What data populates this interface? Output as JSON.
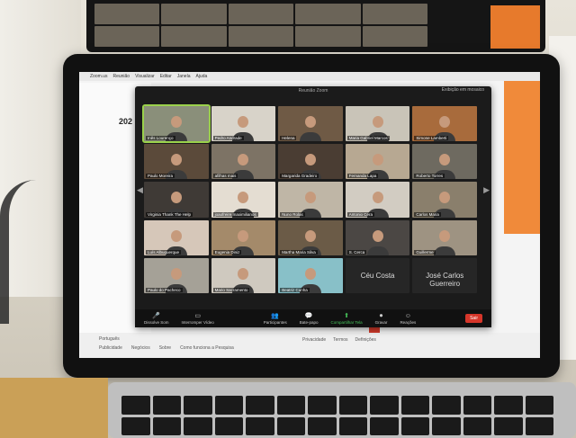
{
  "menubar": {
    "items": [
      "Zoom.us",
      "Reunião",
      "Visualizar",
      "Editar",
      "Janela",
      "Ajuda"
    ]
  },
  "zoom_window": {
    "title": "Reunião Zoom",
    "view_label": "Exibição em mosaico",
    "participants": [
      {
        "name": "Inês Lourenço",
        "active": true
      },
      {
        "name": "Pedro Andrade"
      },
      {
        "name": "Helena"
      },
      {
        "name": "Maria Gabriel Marcos"
      },
      {
        "name": "Simone Lamberti"
      },
      {
        "name": "Paulo Moreira"
      },
      {
        "name": "afilhas mais"
      },
      {
        "name": "Margarida Gradeiro"
      },
      {
        "name": "Fernanda Lapa"
      },
      {
        "name": "Roberto Torres"
      },
      {
        "name": "Virginia Thank The Help"
      },
      {
        "name": "joaofreire.maximilianos"
      },
      {
        "name": "Nuno Rolas"
      },
      {
        "name": "Antonio Cera"
      },
      {
        "name": "Carlos Maria"
      },
      {
        "name": "Luís Albuquerque"
      },
      {
        "name": "Eugenia Diniz"
      },
      {
        "name": "Martha Maria Silva"
      },
      {
        "name": "S. Cerca"
      },
      {
        "name": "Guillerme"
      },
      {
        "name": "Paulo do Pacheco"
      },
      {
        "name": "Mario Sacramento"
      },
      {
        "name": "Beatriz Cunha"
      },
      {
        "name": "Céu Costa",
        "no_video": true
      },
      {
        "name": "José Carlos Guerreiro",
        "no_video": true
      }
    ],
    "controls": {
      "mute": "Dissolve Som",
      "video": "Interromper Vídeo",
      "participants": "Participantes",
      "chat": "Bate-papo",
      "share": "Compartilhar Tela",
      "record": "Gravar",
      "reactions": "Reações",
      "end": "Sair"
    }
  },
  "document": {
    "heading": "202",
    "language": "Português",
    "footer_links": [
      "Publicidade",
      "Negócios",
      "Sobre",
      "Como funciona a Pesquisa"
    ],
    "footer_right": [
      "Privacidade",
      "Termos",
      "Definições"
    ]
  }
}
